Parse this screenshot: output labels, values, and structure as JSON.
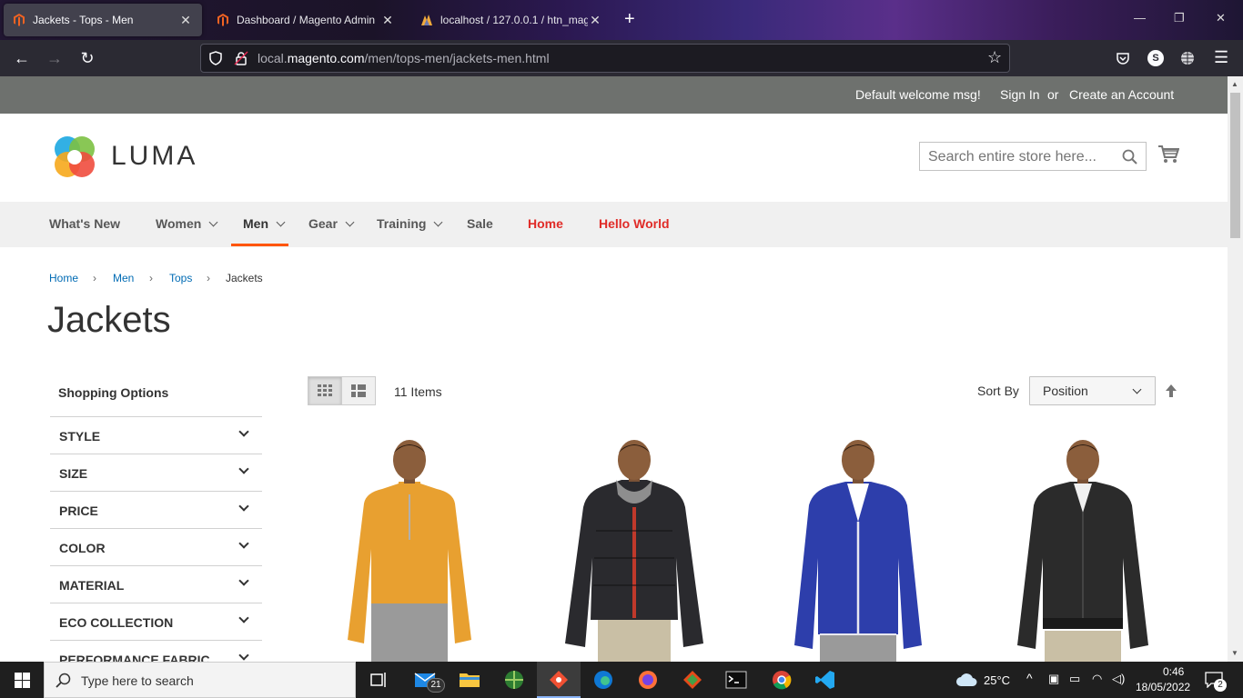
{
  "browser": {
    "tabs": [
      {
        "label": "Jackets - Tops - Men",
        "active": true
      },
      {
        "label": "Dashboard / Magento Admin",
        "active": false
      },
      {
        "label": "localhost / 127.0.0.1 / htn_mag",
        "active": false
      }
    ],
    "url_prefix": "local.",
    "url_domain": "magento.com",
    "url_path": "/men/tops-men/jackets-men.html",
    "profile_initial": "S"
  },
  "panel": {
    "welcome": "Default welcome msg!",
    "sign_in": "Sign In",
    "or": "or",
    "create_account": "Create an Account"
  },
  "header": {
    "logo_text": "LUMA",
    "search_placeholder": "Search entire store here..."
  },
  "nav": {
    "items": [
      {
        "label": "What's New",
        "dropdown": false,
        "style": "normal"
      },
      {
        "label": "Women",
        "dropdown": true,
        "style": "normal"
      },
      {
        "label": "Men",
        "dropdown": true,
        "style": "active"
      },
      {
        "label": "Gear",
        "dropdown": true,
        "style": "normal"
      },
      {
        "label": "Training",
        "dropdown": true,
        "style": "normal"
      },
      {
        "label": "Sale",
        "dropdown": false,
        "style": "normal"
      },
      {
        "label": "Home",
        "dropdown": false,
        "style": "red"
      },
      {
        "label": "Hello World",
        "dropdown": false,
        "style": "red"
      }
    ]
  },
  "breadcrumbs": [
    "Home",
    "Men",
    "Tops",
    "Jackets"
  ],
  "page_title": "Jackets",
  "sidebar": {
    "title": "Shopping Options",
    "filters": [
      "STYLE",
      "SIZE",
      "PRICE",
      "COLOR",
      "MATERIAL",
      "ECO COLLECTION",
      "PERFORMANCE FABRIC"
    ]
  },
  "toolbar": {
    "items_count": "11 Items",
    "sort_label": "Sort By",
    "sort_value": "Position"
  },
  "products": [
    {
      "color": "#e8a030"
    },
    {
      "color": "#2a2a2e"
    },
    {
      "color": "#2d3eab"
    },
    {
      "color": "#2b2b2b"
    }
  ],
  "taskbar": {
    "search_placeholder": "Type here to search",
    "mail_badge": "21",
    "weather": "25°C",
    "time": "0:46",
    "date": "18/05/2022",
    "notifications": "2"
  }
}
